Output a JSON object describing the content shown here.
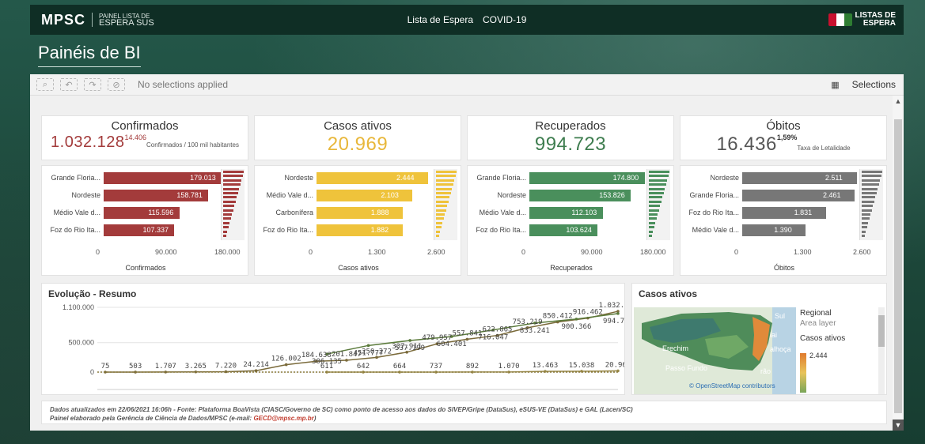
{
  "header": {
    "logo_main": "MPSC",
    "logo_sub1": "PAINEL LISTA DE",
    "logo_sub2": "ESPERA SUS",
    "nav": [
      "Lista de Espera",
      "COVID-19"
    ],
    "brand_right_line1": "LISTAS DE",
    "brand_right_line2": "ESPERA"
  },
  "page_title": "Painéis de BI",
  "toolbar": {
    "no_selections": "No selections applied",
    "selections_label": "Selections"
  },
  "kpis": [
    {
      "title": "Confirmados",
      "value": "1.032.128",
      "sup": "14.406",
      "sub": "Confirmados / 100 mil habitantes",
      "color": "#a33b3b"
    },
    {
      "title": "Casos ativos",
      "value": "20.969",
      "sup": "",
      "sub": "",
      "color": "#e8b73a"
    },
    {
      "title": "Recuperados",
      "value": "994.723",
      "sup": "",
      "sub": "",
      "color": "#3e7d4f"
    },
    {
      "title": "Óbitos",
      "value": "16.436",
      "sup": "1,59%",
      "sub": "Taxa de Letalidade",
      "color": "#555555"
    }
  ],
  "bar_charts": [
    {
      "id": "confirmados",
      "color": "#a33b3b",
      "categories": [
        "Grande Floria...",
        "Nordeste",
        "Médio Vale d...",
        "Foz do Rio Ita..."
      ],
      "values": [
        179013,
        158781,
        115596,
        107337
      ],
      "value_labels": [
        "179.013",
        "158.781",
        "115.596",
        "107.337"
      ],
      "ticks": [
        "0",
        "90.000",
        "180.000"
      ],
      "axis_max": 180000,
      "xlabel": "Confirmados"
    },
    {
      "id": "ativos",
      "color": "#efc33b",
      "categories": [
        "Nordeste",
        "Médio Vale d...",
        "Carbonífera",
        "Foz do Rio Ita..."
      ],
      "values": [
        2444,
        2103,
        1888,
        1882
      ],
      "value_labels": [
        "2.444",
        "2.103",
        "1.888",
        "1.882"
      ],
      "ticks": [
        "0",
        "1.300",
        "2.600"
      ],
      "axis_max": 2600,
      "xlabel": "Casos ativos"
    },
    {
      "id": "recuperados",
      "color": "#4a8f5c",
      "categories": [
        "Grande Floria...",
        "Nordeste",
        "Médio Vale d...",
        "Foz do Rio Ita..."
      ],
      "values": [
        174800,
        153826,
        112103,
        103624
      ],
      "value_labels": [
        "174.800",
        "153.826",
        "112.103",
        "103.624"
      ],
      "ticks": [
        "0",
        "90.000",
        "180.000"
      ],
      "axis_max": 180000,
      "xlabel": "Recuperados"
    },
    {
      "id": "obitos",
      "color": "#777777",
      "categories": [
        "Nordeste",
        "Grande Floria...",
        "Foz do Rio Ita...",
        "Médio Vale d..."
      ],
      "values": [
        2511,
        2461,
        1831,
        1390
      ],
      "value_labels": [
        "2.511",
        "2.461",
        "1.831",
        "1.390"
      ],
      "ticks": [
        "0",
        "1.300",
        "2.600"
      ],
      "axis_max": 2600,
      "xlabel": "Óbitos"
    }
  ],
  "evolucao": {
    "title": "Evolução - Resumo",
    "yticks": [
      "1.100.000",
      "500.000",
      "0"
    ],
    "confirmados_labels": [
      "75",
      "503",
      "1.707",
      "3.265",
      "7.220",
      "24.214",
      "126.002",
      "184.638",
      "201.847",
      "250.272",
      "337.911",
      "479.957",
      "557.841",
      "622.865",
      "753.219",
      "850.412",
      "916.462",
      "1.032.128"
    ],
    "recuperados_labels": [
      "306.135",
      "451.777",
      "537.199",
      "604.401",
      "716.047",
      "833.241",
      "900.366",
      "994.723"
    ],
    "ativos_labels": [
      "611",
      "642",
      "664",
      "737",
      "892",
      "1.070",
      "13.463",
      "15.038",
      "20.969"
    ]
  },
  "map": {
    "title": "Casos ativos",
    "legend_title": "Regional",
    "legend_layer": "Area layer",
    "legend_measure": "Casos ativos",
    "legend_max": "2.444",
    "place_labels": [
      "Sul",
      "Erechim",
      "Passo Fundo",
      "lai",
      "alhoça",
      "rão"
    ],
    "attribution": "© OpenStreetMap contributors"
  },
  "footer": {
    "line1": "Dados atualizados em 22/06/2021 16:06h - Fonte: Plataforma BoaVista (CIASC/Governo de SC) como ponto de acesso aos dados do SIVEP/Gripe (DataSus), eSUS-VE (DataSus) e GAL (Lacen/SC)",
    "line2": "Painel elaborado pela Gerência de Ciência de Dados/MPSC (e-mail:",
    "email": "GECD@mpsc.mp.br",
    "line2_end": ")"
  },
  "chart_data": [
    {
      "type": "bar",
      "categories": [
        "Grande Floria...",
        "Nordeste",
        "Médio Vale d...",
        "Foz do Rio Ita..."
      ],
      "values": [
        179013,
        158781,
        115596,
        107337
      ],
      "xlabel": "Confirmados",
      "xlim": [
        0,
        180000
      ]
    },
    {
      "type": "bar",
      "categories": [
        "Nordeste",
        "Médio Vale d...",
        "Carbonífera",
        "Foz do Rio Ita..."
      ],
      "values": [
        2444,
        2103,
        1888,
        1882
      ],
      "xlabel": "Casos ativos",
      "xlim": [
        0,
        2600
      ]
    },
    {
      "type": "bar",
      "categories": [
        "Grande Floria...",
        "Nordeste",
        "Médio Vale d...",
        "Foz do Rio Ita..."
      ],
      "values": [
        174800,
        153826,
        112103,
        103624
      ],
      "xlabel": "Recuperados",
      "xlim": [
        0,
        180000
      ]
    },
    {
      "type": "bar",
      "categories": [
        "Nordeste",
        "Grande Floria...",
        "Foz do Rio Ita...",
        "Médio Vale d..."
      ],
      "values": [
        2511,
        2461,
        1831,
        1390
      ],
      "xlabel": "Óbitos",
      "xlim": [
        0,
        2600
      ]
    },
    {
      "type": "line",
      "title": "Evolução - Resumo",
      "ylim": [
        0,
        1100000
      ],
      "series": [
        {
          "name": "Confirmados",
          "values": [
            75,
            503,
            1707,
            3265,
            7220,
            24214,
            126002,
            184638,
            201847,
            250272,
            337911,
            479957,
            557841,
            622865,
            753219,
            850412,
            916462,
            1032128
          ]
        },
        {
          "name": "Recuperados",
          "values": [
            306135,
            451777,
            537199,
            604401,
            716047,
            833241,
            900366,
            994723
          ]
        },
        {
          "name": "Casos ativos",
          "values": [
            611,
            642,
            664,
            737,
            892,
            1070,
            13463,
            15038,
            20969
          ]
        }
      ]
    }
  ]
}
